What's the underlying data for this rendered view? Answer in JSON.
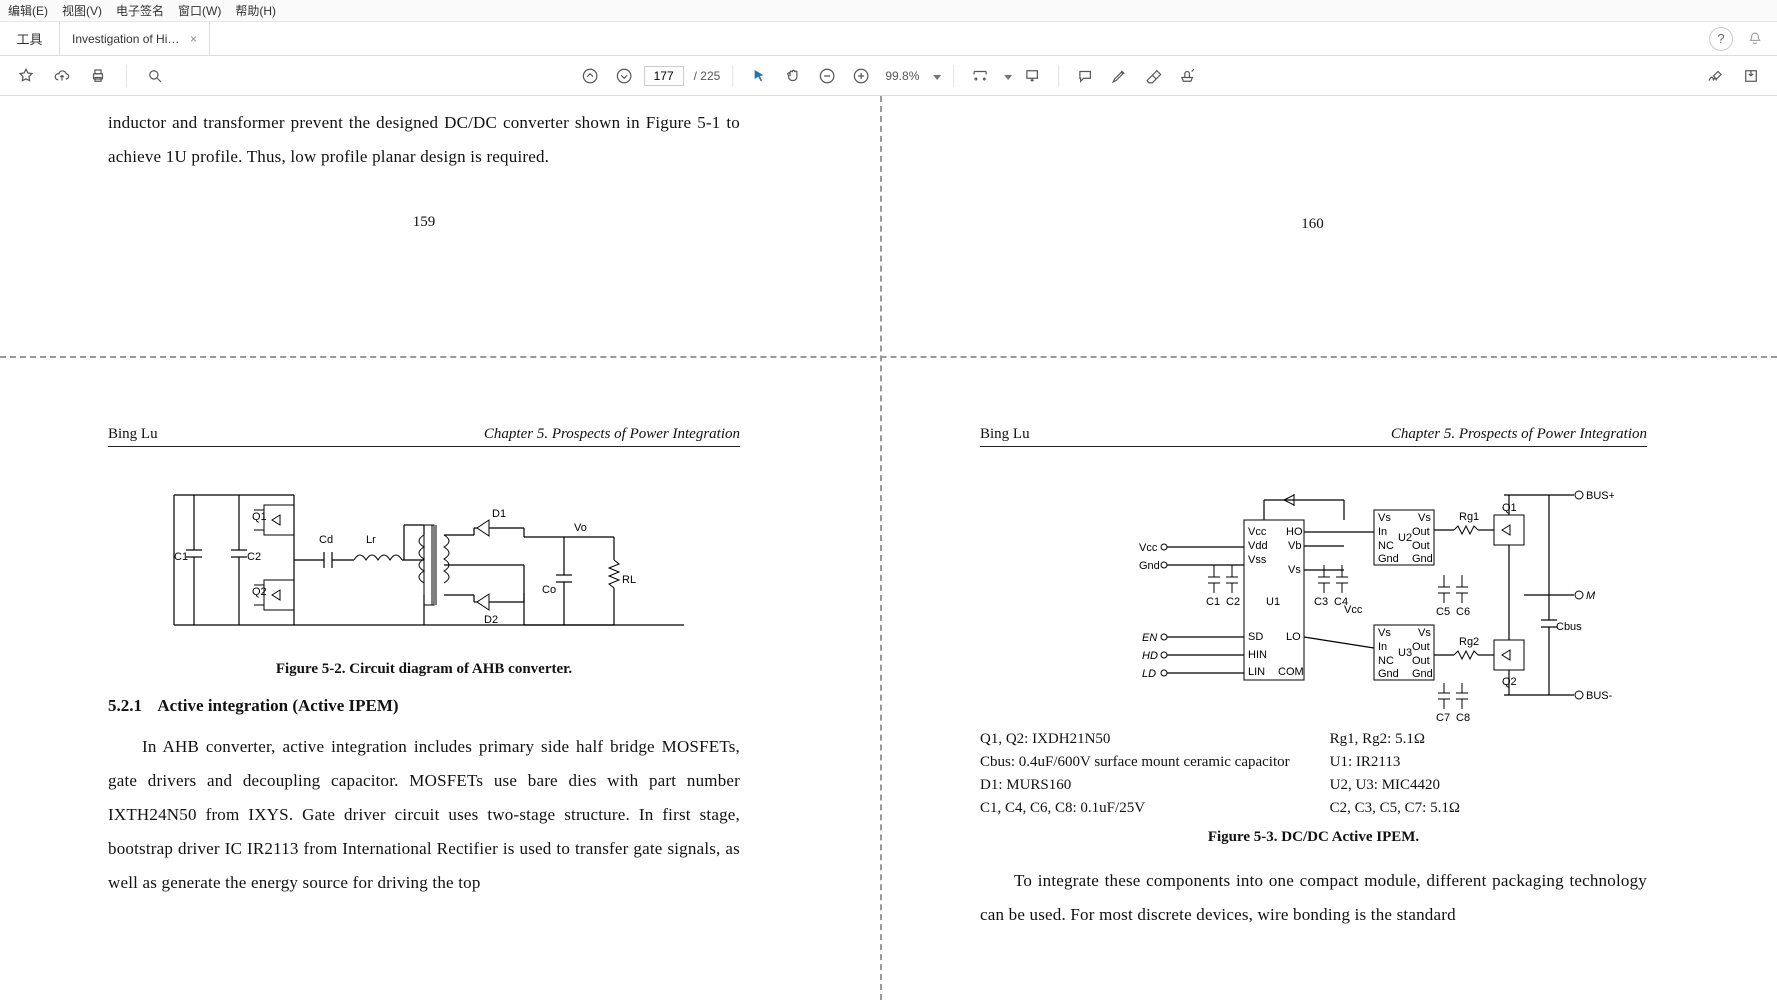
{
  "menu": {
    "edit": "编辑(E)",
    "view": "视图(V)",
    "sign": "电子签名",
    "window": "窗口(W)",
    "help": "帮助(H)"
  },
  "tabs": {
    "tools": "工具",
    "doc_title": "Investigation of Hig...",
    "close": "×"
  },
  "toolbar": {
    "page_current": "177",
    "page_total": "/ 225",
    "zoom": "99.8%"
  },
  "doc": {
    "q1": {
      "para": "inductor and transformer prevent the designed DC/DC converter shown in Figure 5-1 to achieve 1U profile. Thus, low profile planar design is required.",
      "page_number": "159"
    },
    "q2": {
      "page_number": "160"
    },
    "q3": {
      "author": "Bing Lu",
      "chapter": "Chapter 5. Prospects of Power Integration",
      "fig_caption": "Figure 5-2. Circuit diagram of AHB converter.",
      "sec_num": "5.2.1",
      "sec_title": "Active integration (Active IPEM)",
      "para": "In AHB converter, active integration includes primary side half bridge MOSFETs, gate drivers and decoupling capacitor. MOSFETs use bare dies with part number IXTH24N50 from IXYS. Gate driver circuit uses two-stage structure. In first stage, bootstrap driver IC IR2113 from International Rectifier is used to transfer gate signals, as well as generate the energy source for driving the top",
      "schem": {
        "Q1": "Q1",
        "Q2": "Q2",
        "C1": "C1",
        "C2": "C2",
        "Cd": "Cd",
        "Lr": "Lr",
        "D1": "D1",
        "D2": "D2",
        "Co": "Co",
        "RL": "RL",
        "Vo": "Vo"
      }
    },
    "q4": {
      "author": "Bing Lu",
      "chapter": "Chapter 5. Prospects of Power Integration",
      "fig_caption": "Figure 5-3. DC/DC Active IPEM.",
      "para": "To integrate these components into one compact module, different packaging technology can be used. For most discrete devices, wire bonding is the standard",
      "parts_left": [
        "Q1, Q2: IXDH21N50",
        "Cbus: 0.4uF/600V surface mount ceramic capacitor",
        "D1: MURS160",
        "C1, C4, C6, C8: 0.1uF/25V"
      ],
      "parts_right": [
        "Rg1, Rg2: 5.1Ω",
        "U1: IR2113",
        "U2, U3: MIC4420",
        "C2, C3, C5, C7: 5.1Ω"
      ],
      "schem": {
        "Vcc": "Vcc",
        "Gnd": "Gnd",
        "EN": "EN",
        "HD": "HD",
        "LD": "LD",
        "U1": "U1",
        "U2": "U2",
        "U3": "U3",
        "Vs": "Vs",
        "In": "In",
        "Out": "Out",
        "NC": "NC",
        "HO": "HO",
        "LO": "LO",
        "Vb": "Vb",
        "Vdd": "Vdd",
        "Vss": "Vss",
        "COM": "COM",
        "SD": "SD",
        "HIN": "HIN",
        "LIN": "LIN",
        "C1": "C1",
        "C2": "C2",
        "C3": "C3",
        "C4": "C4",
        "C5": "C5",
        "C6": "C6",
        "C7": "C7",
        "C8": "C8",
        "Rg1": "Rg1",
        "Rg2": "Rg2",
        "Q1": "Q1",
        "Q2": "Q2",
        "Cbus": "Cbus",
        "BUSp": "BUS+",
        "BUSm": "BUS-",
        "M": "M"
      }
    }
  }
}
